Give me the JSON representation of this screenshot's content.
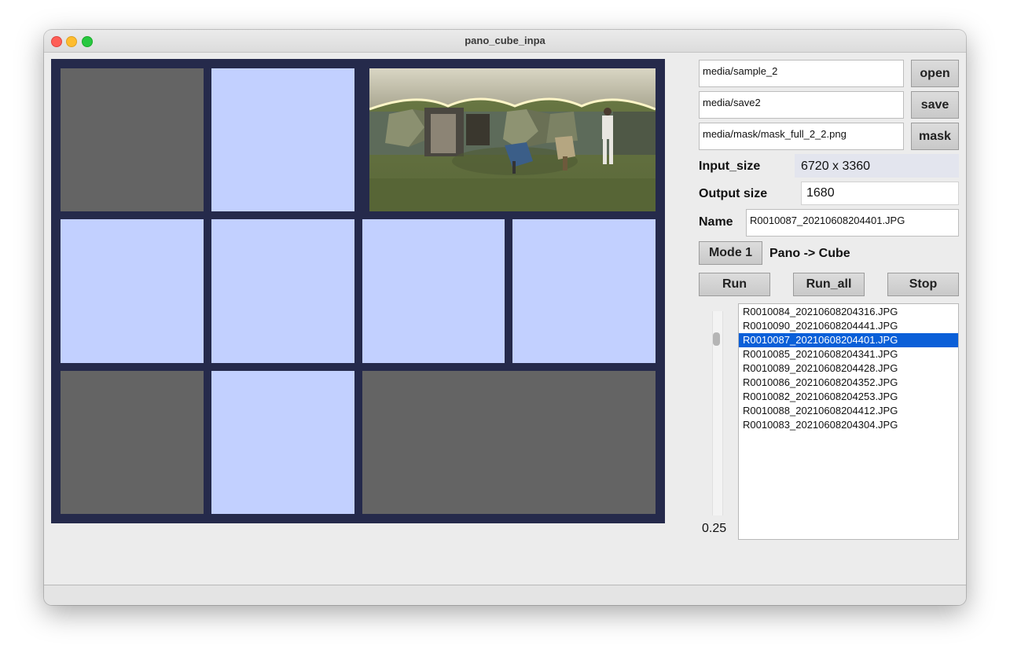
{
  "window": {
    "title": "pano_cube_inpa"
  },
  "controls": {
    "input_path": "media/sample_2",
    "open_label": "open",
    "save_path": "media/save2",
    "save_label": "save",
    "mask_path": "media/mask/mask_full_2_2.png",
    "mask_label": "mask",
    "input_size_label": "Input_size",
    "input_size_value": "6720 x 3360",
    "output_size_label": "Output size",
    "output_size_value": "1680",
    "name_label": "Name",
    "name_value": "R0010087_20210608204401.JPG",
    "mode_button": "Mode 1",
    "mode_text": "Pano -> Cube",
    "run_label": "Run",
    "run_all_label": "Run_all",
    "stop_label": "Stop"
  },
  "slider": {
    "value": "0.25",
    "level": 0.25
  },
  "file_list": {
    "items": [
      "R0010084_20210608204316.JPG",
      "R0010090_20210608204441.JPG",
      "R0010087_20210608204401.JPG",
      "R0010085_20210608204341.JPG",
      "R0010089_20210608204428.JPG",
      "R0010086_20210608204352.JPG",
      "R0010082_20210608204253.JPG",
      "R0010088_20210608204412.JPG",
      "R0010083_20210608204304.JPG"
    ],
    "selected_index": 2
  },
  "colors": {
    "canvas_bg": "#252a4b",
    "face_gray": "#646464",
    "face_blue": "#c2d0ff",
    "selection": "#0a5fd8"
  }
}
